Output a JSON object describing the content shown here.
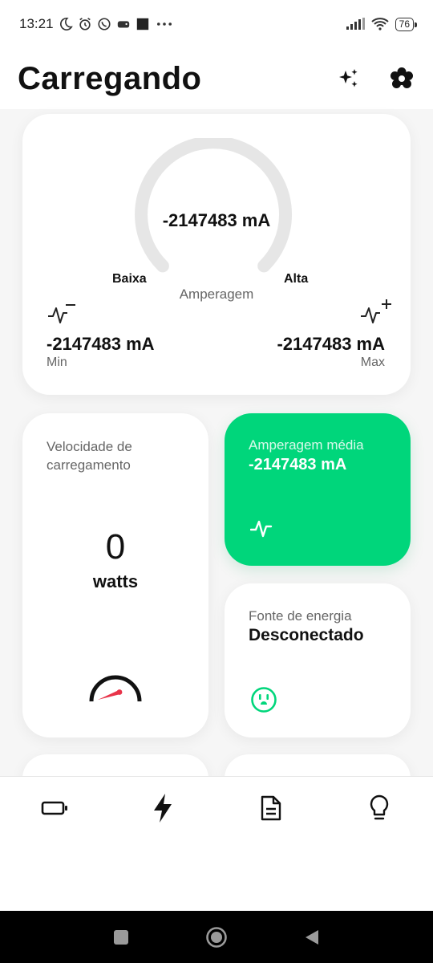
{
  "status_bar": {
    "time": "13:21",
    "battery_level": "76",
    "icons": [
      "moon-icon",
      "alarm-icon",
      "whatsapp-icon",
      "game-icon",
      "square-icon",
      "more-dots-icon",
      "signal-icon",
      "wifi-icon",
      "battery-icon"
    ]
  },
  "header": {
    "title": "Carregando",
    "actions": [
      "sparkles-icon",
      "settings-icon"
    ]
  },
  "amperage_card": {
    "current_value": "-2147483 mA",
    "low_label": "Baixa",
    "high_label": "Alta",
    "caption": "Amperagem",
    "min_value": "-2147483 mA",
    "min_label": "Min",
    "max_value": "-2147483 mA",
    "max_label": "Max"
  },
  "speed_card": {
    "title": "Velocidade de carregamento",
    "value": "0",
    "unit": "watts"
  },
  "average_card": {
    "title": "Amperagem média",
    "value": "-2147483 mA"
  },
  "power_source_card": {
    "title": "Fonte de energia",
    "value": "Desconectado"
  },
  "bottom_nav": {
    "items": [
      "battery-icon",
      "bolt-icon",
      "document-icon",
      "lightbulb-icon"
    ],
    "active": "bolt-icon"
  },
  "colors": {
    "accent": "#00d67b",
    "gauge_track": "#e6e6e6",
    "background": "#f6f6f6"
  }
}
